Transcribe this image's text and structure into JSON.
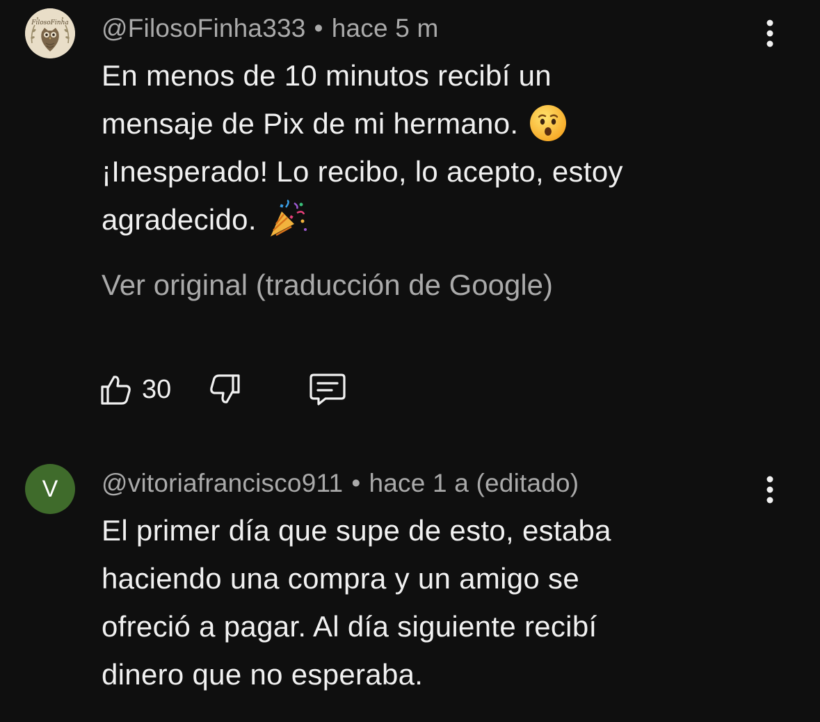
{
  "comments": [
    {
      "author": "@FilosoFinha333",
      "separator": "•",
      "time": "hace 5 m",
      "avatar_text": "FilosoFinha",
      "lines": [
        "En menos de 10 minutos recibí un",
        "mensaje de Pix de mi hermano.",
        "¡Inesperado! Lo recibo, lo acepto, estoy",
        "agradecido."
      ],
      "emojis": [
        "hushed-face-emoji",
        "party-popper-emoji"
      ],
      "translate_label": "Ver original (traducción de Google)",
      "like_count": "30"
    },
    {
      "author": "@vitoriafrancisco911",
      "separator": "•",
      "time": "hace 1 a (editado)",
      "avatar_letter": "V",
      "avatar_color": "#3f6b2b",
      "lines": [
        "El primer día que supe de esto, estaba",
        "haciendo una compra y un amigo se",
        "ofreció a pagar. Al día siguiente recibí",
        "dinero que no esperaba."
      ]
    }
  ],
  "theme": {
    "background": "#0f0f0f",
    "text_primary": "#f1f1f1",
    "text_secondary": "#aaaaaa"
  }
}
